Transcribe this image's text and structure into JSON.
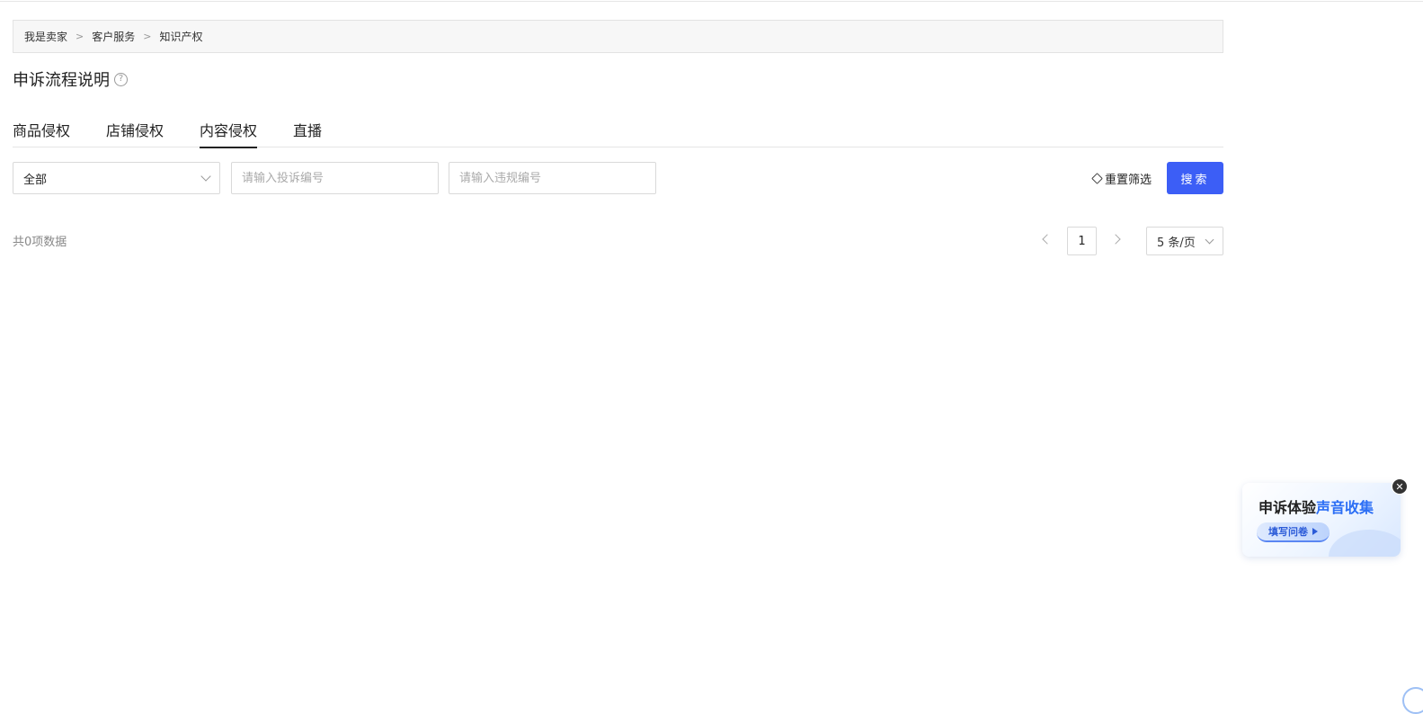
{
  "breadcrumb": {
    "items": [
      "我是卖家",
      "客户服务",
      "知识产权"
    ],
    "separator": ">"
  },
  "page_title": "申诉流程说明",
  "help_icon_glyph": "?",
  "tabs": [
    {
      "label": "商品侵权",
      "active": false
    },
    {
      "label": "店铺侵权",
      "active": false
    },
    {
      "label": "内容侵权",
      "active": true
    },
    {
      "label": "直播",
      "active": false
    }
  ],
  "filters": {
    "type_select_value": "全部",
    "complaint_no_placeholder": "请输入投诉编号",
    "violation_no_placeholder": "请输入违规编号",
    "reset_label": "重置筛选",
    "search_label": "搜索"
  },
  "pagination": {
    "total_text": "共0项数据",
    "current_page": "1",
    "page_size": "5 条/页"
  },
  "survey_widget": {
    "title_part1": "申诉体验",
    "title_part2": "声音收集",
    "button_label": "填写问卷",
    "close_glyph": "✕"
  },
  "colors": {
    "primary": "#3c5ef6",
    "survey_highlight": "#2b6ef5"
  }
}
